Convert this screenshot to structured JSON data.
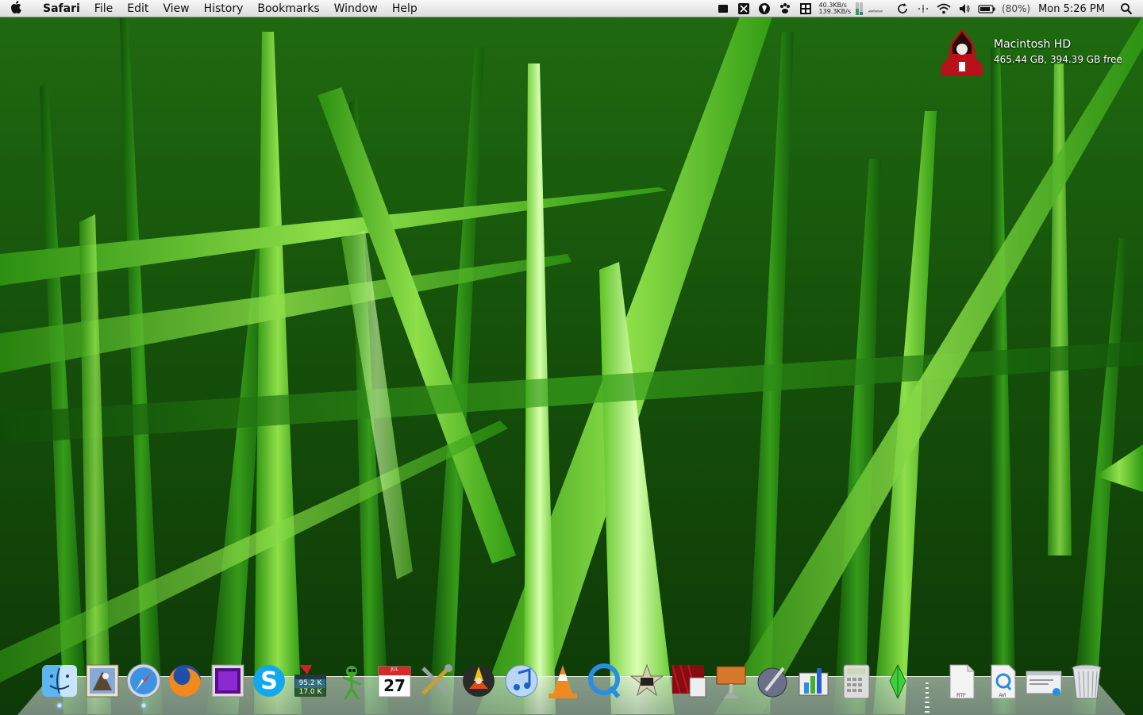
{
  "menubar": {
    "apple_icon": "apple-logo",
    "app_name": "Safari",
    "menus": [
      "File",
      "Edit",
      "View",
      "History",
      "Bookmarks",
      "Window",
      "Help"
    ],
    "status": {
      "net_up": "40.3KB/s",
      "net_down": "139.3KB/s",
      "battery_percent": "(80%)",
      "clock": "Mon 5:26 PM"
    }
  },
  "desktop": {
    "drive": {
      "name": "Macintosh HD",
      "info": "465.44 GB, 394.39 GB free"
    }
  },
  "dock": {
    "apps": [
      {
        "name": "Finder",
        "icon": "finder-icon"
      },
      {
        "name": "Mail",
        "icon": "mail-icon"
      },
      {
        "name": "Safari",
        "icon": "safari-icon"
      },
      {
        "name": "Firefox",
        "icon": "firefox-icon"
      },
      {
        "name": "App",
        "icon": "purple-square-icon"
      },
      {
        "name": "Skype",
        "icon": "skype-icon"
      },
      {
        "name": "Network Monitor",
        "icon": "network-monitor-icon",
        "labels": [
          "95.2 K",
          "17.0 K"
        ]
      },
      {
        "name": "Adium",
        "icon": "adium-icon"
      },
      {
        "name": "iCal",
        "icon": "calendar-icon",
        "month": "JUL",
        "day": "27"
      },
      {
        "name": "Utilities",
        "icon": "tools-icon"
      },
      {
        "name": "Burn",
        "icon": "burn-icon"
      },
      {
        "name": "iTunes",
        "icon": "itunes-icon"
      },
      {
        "name": "VLC",
        "icon": "vlc-icon"
      },
      {
        "name": "QuickTime",
        "icon": "quicktime-icon"
      },
      {
        "name": "iMovie",
        "icon": "imovie-icon"
      },
      {
        "name": "Front Row",
        "icon": "front-row-icon"
      },
      {
        "name": "Keynote",
        "icon": "keynote-icon"
      },
      {
        "name": "Photo Booth",
        "icon": "photo-icon"
      },
      {
        "name": "Numbers",
        "icon": "numbers-icon"
      },
      {
        "name": "Calculator",
        "icon": "calculator-icon"
      },
      {
        "name": "The Sims 3",
        "icon": "sims-icon"
      }
    ],
    "docs": [
      {
        "name": "RTF",
        "icon": "rtf-doc-icon",
        "label": "RTF"
      },
      {
        "name": "AVI",
        "icon": "avi-doc-icon",
        "label": "AVI"
      },
      {
        "name": "Window",
        "icon": "window-icon"
      },
      {
        "name": "Trash",
        "icon": "trash-icon"
      }
    ]
  }
}
